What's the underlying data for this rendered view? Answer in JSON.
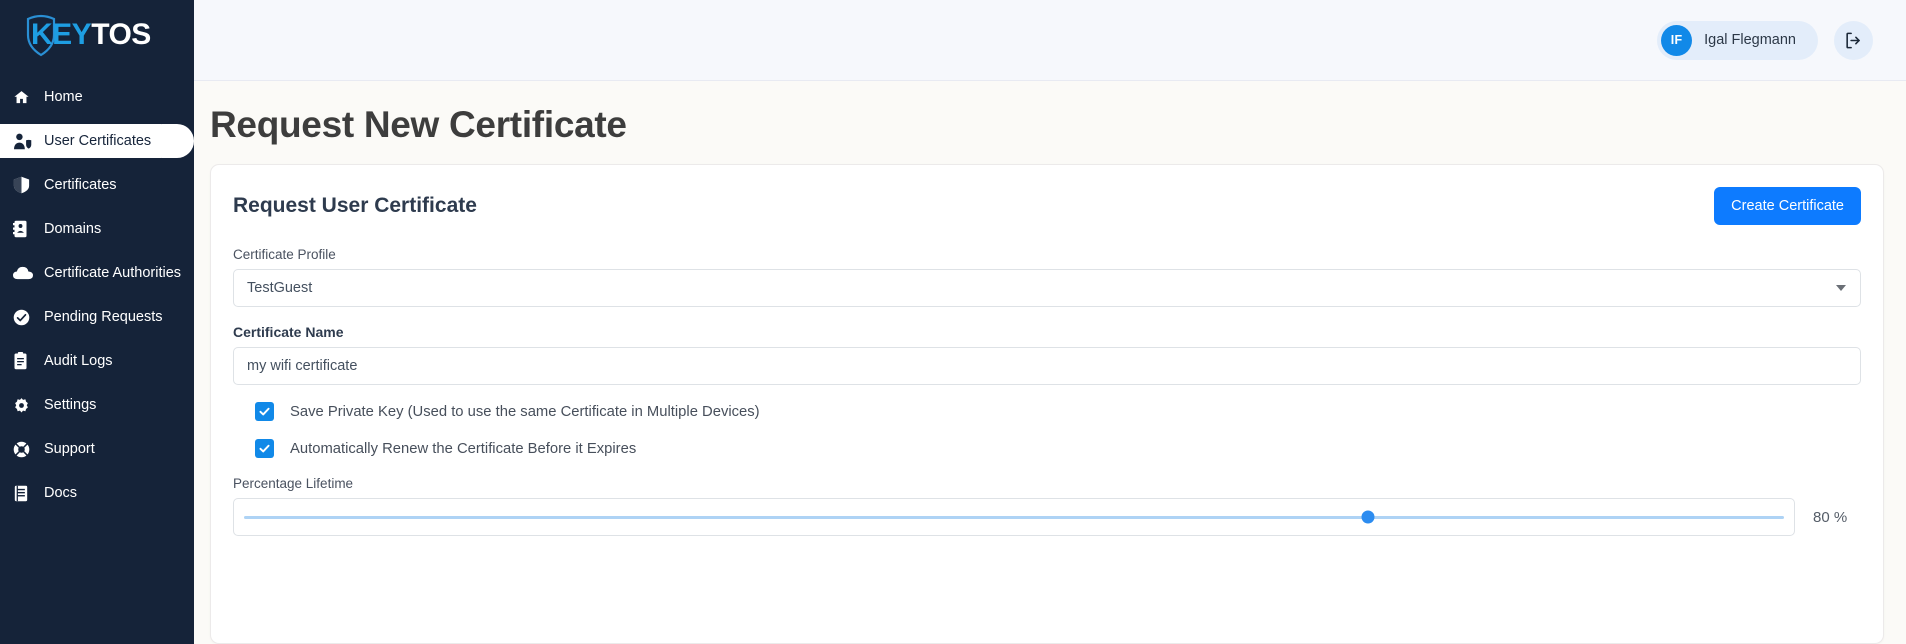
{
  "brand": {
    "name_part1": "KEY",
    "name_part2": "TOS",
    "logo_icon": "shield-icon",
    "color_blue": "#1e9ee3",
    "color_white": "#ffffff",
    "sidebar_bg": "#152339"
  },
  "sidebar": {
    "items": [
      {
        "label": "Home",
        "icon": "home-icon",
        "active": false
      },
      {
        "label": "User Certificates",
        "icon": "user-shield-icon",
        "active": true
      },
      {
        "label": "Certificates",
        "icon": "shield-icon",
        "active": false
      },
      {
        "label": "Domains",
        "icon": "address-book-icon",
        "active": false
      },
      {
        "label": "Certificate Authorities",
        "icon": "cloud-icon",
        "active": false
      },
      {
        "label": "Pending Requests",
        "icon": "check-circle-icon",
        "active": false
      },
      {
        "label": "Audit Logs",
        "icon": "clipboard-icon",
        "active": false
      },
      {
        "label": "Settings",
        "icon": "gear-icon",
        "active": false
      },
      {
        "label": "Support",
        "icon": "lifebuoy-icon",
        "active": false
      },
      {
        "label": "Docs",
        "icon": "book-icon",
        "active": false
      }
    ]
  },
  "topbar": {
    "user_initials": "IF",
    "user_name": "Igal Flegmann",
    "logout_icon": "logout-icon",
    "accent": "#1189e8",
    "chip_bg": "#e3edfa"
  },
  "page": {
    "title": "Request New Certificate"
  },
  "card": {
    "title": "Request User Certificate",
    "create_button": "Create Certificate",
    "create_button_color": "#0d7bff"
  },
  "form": {
    "profile": {
      "label": "Certificate Profile",
      "value": "TestGuest",
      "caret_icon": "chevron-down-icon"
    },
    "certificate_name": {
      "label": "Certificate Name",
      "value": "my wifi certificate",
      "placeholder": "Certificate Name"
    },
    "checkboxes": [
      {
        "label": "Save Private Key (Used to use the same Certificate in Multiple Devices)",
        "checked": true
      },
      {
        "label": "Automatically Renew the Certificate Before it Expires",
        "checked": true
      }
    ],
    "percentage_lifetime": {
      "label": "Percentage Lifetime",
      "value": 80,
      "display": "80 %",
      "min": 0,
      "max": 100,
      "thumb_position_percent": 73,
      "track_color": "#aed3f5",
      "thumb_color": "#2c8cf0"
    }
  }
}
